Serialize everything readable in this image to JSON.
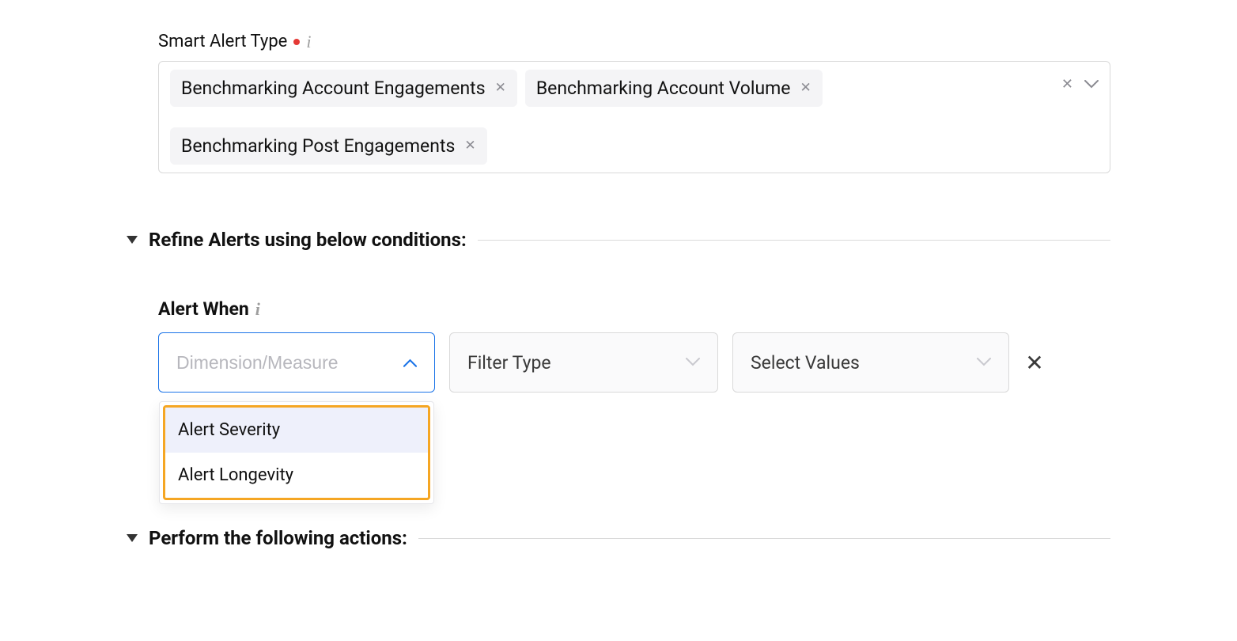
{
  "smartAlert": {
    "label": "Smart Alert Type",
    "chips": [
      "Benchmarking Account Engagements",
      "Benchmarking Account Volume",
      "Benchmarking Post Engagements"
    ]
  },
  "refine": {
    "title": "Refine Alerts using below conditions:"
  },
  "alertWhen": {
    "label": "Alert When",
    "dimPlaceholder": "Dimension/Measure",
    "filterTypePlaceholder": "Filter Type",
    "valuesPlaceholder": "Select Values",
    "options": [
      "Alert Severity",
      "Alert Longevity"
    ]
  },
  "actions": {
    "title": "Perform the following actions:"
  }
}
